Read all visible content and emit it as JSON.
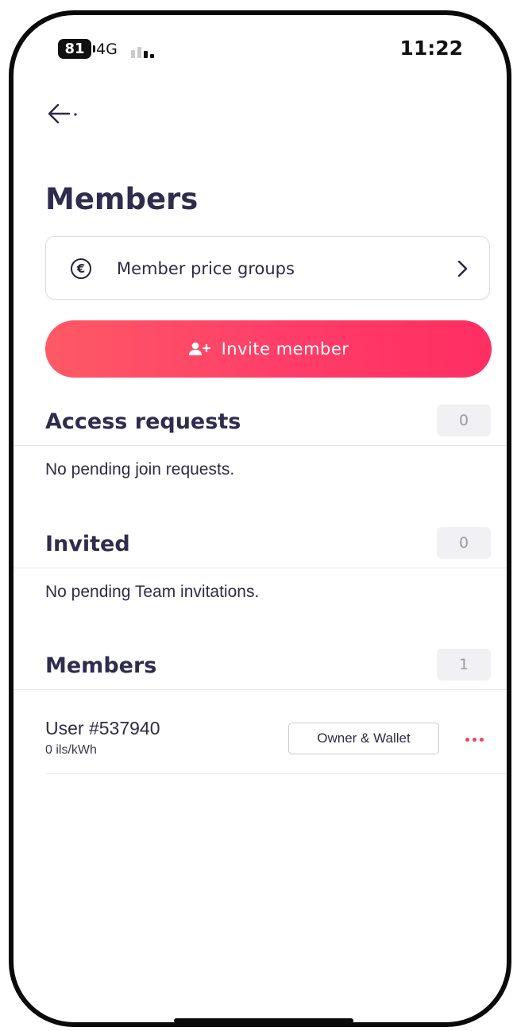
{
  "status_bar": {
    "battery_level": "81",
    "network_type": "4G",
    "time": "11:22"
  },
  "header": {
    "back_icon": "arrow-left-icon",
    "title": "Members"
  },
  "price_groups": {
    "icon": "euro-circle-icon",
    "label": "Member price groups",
    "chevron_icon": "chevron-right-icon"
  },
  "invite": {
    "icon": "add-user-icon",
    "label": "Invite member",
    "gradient_start": "#fd5966",
    "gradient_end": "#ff2e63"
  },
  "sections": {
    "access_requests": {
      "title": "Access requests",
      "count": "0",
      "empty_text": "No pending join requests."
    },
    "invited": {
      "title": "Invited",
      "count": "0",
      "empty_text": "No pending Team invitations."
    },
    "members": {
      "title": "Members",
      "count": "1",
      "items": [
        {
          "name": "User #537940",
          "rate": "0 ils/kWh",
          "role": "Owner & Wallet",
          "more_icon": "more-dots-icon"
        }
      ]
    }
  },
  "colors": {
    "heading": "#302c4e",
    "accent": "#ff3d68",
    "more_dots": "#ef4752",
    "badge_bg": "#f1f1f3"
  }
}
